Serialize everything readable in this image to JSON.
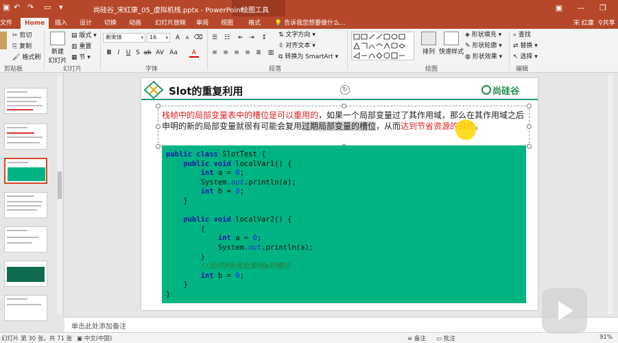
{
  "window": {
    "title": "尚硅谷_宋红康_05_虚拟机栈.pptx - PowerPoint",
    "tools_title": "绘图工具",
    "user": "宋 红康",
    "share": "共享"
  },
  "tabs": [
    {
      "label": "文件",
      "active": false
    },
    {
      "label": "Home",
      "active": true
    },
    {
      "label": "插入",
      "active": false
    },
    {
      "label": "设计",
      "active": false
    },
    {
      "label": "切换",
      "active": false
    },
    {
      "label": "动画",
      "active": false
    },
    {
      "label": "幻灯片放映",
      "active": false
    },
    {
      "label": "审阅",
      "active": false
    },
    {
      "label": "视图",
      "active": false
    },
    {
      "label": "格式",
      "active": false
    }
  ],
  "tellme": "告诉我您想要做什么...",
  "ribbon": {
    "clipboard": {
      "cut": "剪切",
      "copy": "复制",
      "painter": "格式刷",
      "group": "剪贴板"
    },
    "slides": {
      "new": "新建",
      "new2": "幻灯片",
      "layout": "版式",
      "reset": "重置",
      "section": "节",
      "group": "幻灯片"
    },
    "font": {
      "name": "新宋体",
      "size": "16",
      "group": "字体"
    },
    "paragraph": {
      "direction": "文字方向",
      "align": "对齐文本",
      "smartart": "转换为 SmartArt",
      "group": "段落"
    },
    "drawing": {
      "arrange": "排列",
      "quickstyles": "快速样式",
      "fill": "形状填充",
      "outline": "形状轮廓",
      "effects": "形状效果",
      "group": "绘图"
    },
    "editing": {
      "find": "查找",
      "replace": "替换",
      "select": "选择",
      "group": "编辑"
    }
  },
  "slide": {
    "title": "Slot的重复利用",
    "brand": "尚硅谷",
    "para_red1": "栈帧中的局部变量表中的槽位是可以重用的",
    "para_mid": "，如果一个局部变量过了其作用域，那么在其作用域之后申明的新的局部变量就很有可能会复用",
    "para_hl": "过期局部变量的槽位",
    "para_mid2": "，从而",
    "para_red2": "达到节省资源的目的",
    "para_end": "。",
    "code": [
      [
        "public class",
        " SlotTest {"
      ],
      [
        "    public void",
        " localVar1() {"
      ],
      [
        "        int",
        " a = ",
        "0",
        ";"
      ],
      [
        "        System.",
        "out",
        ".println(a);"
      ],
      [
        "        int",
        " b = ",
        "0",
        ";"
      ],
      [
        "    }"
      ],
      [
        ""
      ],
      [
        "    public void",
        " localVar2() {"
      ],
      [
        "        {"
      ],
      [
        "            int",
        " a = ",
        "0",
        ";"
      ],
      [
        "            System.",
        "out",
        ".println(a);"
      ],
      [
        "        }"
      ],
      [
        "        //此时的b就会复用a的槽位"
      ],
      [
        "        int",
        " b = ",
        "0",
        ";"
      ],
      [
        "    }"
      ],
      [
        "}"
      ]
    ]
  },
  "notes": "单击此处添加备注",
  "status": {
    "slide": "幻灯片 第 30 张，共 71 张",
    "lang": "中文(中国)",
    "notes": "备注",
    "comments": "批注",
    "zoom": "91%"
  }
}
